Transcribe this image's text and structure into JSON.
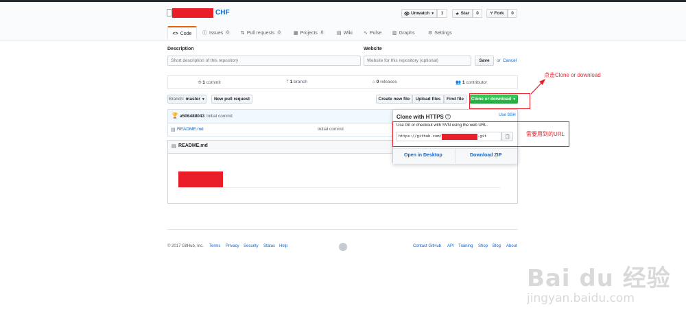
{
  "repo": {
    "name": "CHF"
  },
  "header_actions": {
    "unwatch": {
      "label": "Unwatch",
      "count": "1"
    },
    "star": {
      "label": "Star",
      "count": "0"
    },
    "fork": {
      "label": "Fork",
      "count": "0"
    }
  },
  "tabs": [
    {
      "label": "Code",
      "count": ""
    },
    {
      "label": "Issues",
      "count": "0"
    },
    {
      "label": "Pull requests",
      "count": "0"
    },
    {
      "label": "Projects",
      "count": "0"
    },
    {
      "label": "Wiki",
      "count": ""
    },
    {
      "label": "Pulse",
      "count": ""
    },
    {
      "label": "Graphs",
      "count": ""
    },
    {
      "label": "Settings",
      "count": ""
    }
  ],
  "about": {
    "description_label": "Description",
    "description_placeholder": "Short description of this repository",
    "website_label": "Website",
    "website_placeholder": "Website for this repository (optional)",
    "save_label": "Save",
    "or_text": "or",
    "cancel_label": "Cancel"
  },
  "summary": {
    "commits": {
      "num": "1",
      "label": "commit"
    },
    "branches": {
      "num": "1",
      "label": "branch"
    },
    "releases": {
      "num": "0",
      "label": "releases"
    },
    "contributors": {
      "num": "1",
      "label": "contributor"
    }
  },
  "toolbar": {
    "branch_prefix": "Branch:",
    "branch_name": "master",
    "new_pr": "New pull request",
    "create_file": "Create new file",
    "upload": "Upload files",
    "find": "Find file",
    "clone": "Clone or download"
  },
  "commit": {
    "author": "a506488043",
    "message": "Initial commit"
  },
  "files": [
    {
      "name": "README.md",
      "message": "Initial commit"
    }
  ],
  "readme": {
    "title": "README.md"
  },
  "clone_dropdown": {
    "title": "Clone with HTTPS",
    "help": "?",
    "use_ssh": "Use SSH",
    "description": "Use Git or checkout with SVN using the web URL.",
    "url_prefix": "https://github.com/",
    "url_suffix": ".git",
    "open_desktop": "Open in Desktop",
    "download_zip": "Download ZIP"
  },
  "footer": {
    "copyright": "© 2017 GitHub, Inc.",
    "left_links": [
      "Terms",
      "Privacy",
      "Security",
      "Status",
      "Help"
    ],
    "right_links": [
      "Contact GitHub",
      "API",
      "Training",
      "Shop",
      "Blog",
      "About"
    ]
  },
  "annotations": {
    "click_clone": "点击Clone or download",
    "needed_url": "需要用到的URL"
  },
  "watermark": {
    "brand": "Bai du 经验",
    "url": "jingyan.baidu.com"
  },
  "colors": {
    "accent": "#0366d6",
    "primary_green": "#28a745",
    "annotation_red": "#ea1e29",
    "tab_orange": "#e36209"
  }
}
